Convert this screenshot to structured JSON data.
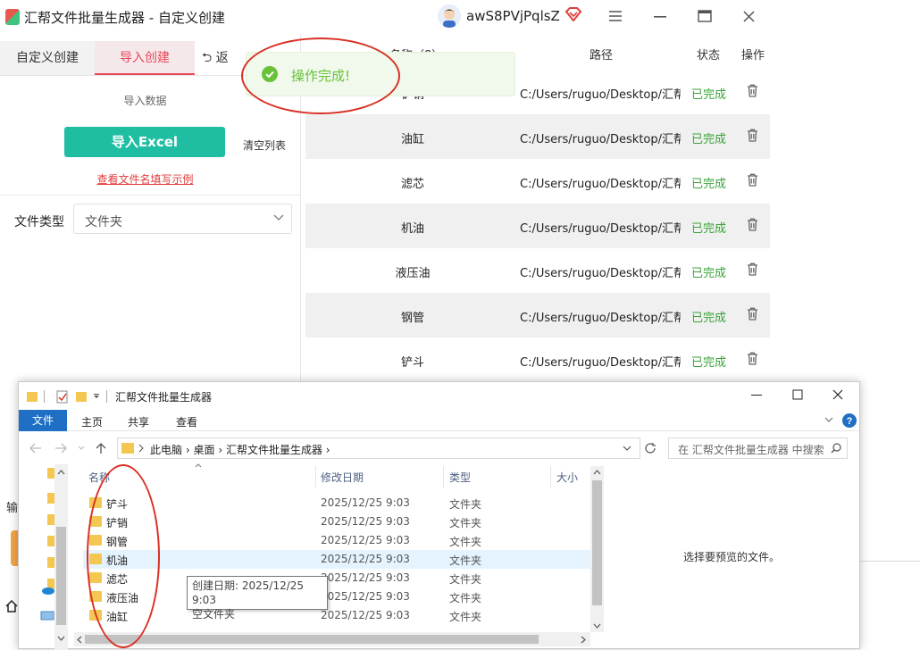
{
  "app": {
    "title": "汇帮文件批量生成器 - 自定义创建",
    "username": "awS8PVjPqlsZ"
  },
  "tabs": {
    "custom": "自定义创建",
    "import": "导入创建",
    "back": "返"
  },
  "left": {
    "import_data_label": "导入数据",
    "import_excel": "导入Excel",
    "clear_list": "清空列表",
    "example_link": "查看文件名填写示例",
    "file_type_label": "文件类型",
    "file_type_value": "文件夹",
    "out_label": "输"
  },
  "table": {
    "headers": {
      "name": "名称（8）",
      "path": "路径",
      "status": "状态",
      "op": "操作"
    },
    "rows": [
      {
        "name": "铲销",
        "path": "C:/Users/ruguo/Desktop/汇帮文",
        "status": "已完成"
      },
      {
        "name": "油缸",
        "path": "C:/Users/ruguo/Desktop/汇帮文",
        "status": "已完成"
      },
      {
        "name": "滤芯",
        "path": "C:/Users/ruguo/Desktop/汇帮文",
        "status": "已完成"
      },
      {
        "name": "机油",
        "path": "C:/Users/ruguo/Desktop/汇帮文",
        "status": "已完成"
      },
      {
        "name": "液压油",
        "path": "C:/Users/ruguo/Desktop/汇帮文",
        "status": "已完成"
      },
      {
        "name": "钢管",
        "path": "C:/Users/ruguo/Desktop/汇帮文",
        "status": "已完成"
      },
      {
        "name": "铲斗",
        "path": "C:/Users/ruguo/Desktop/汇帮文",
        "status": "已完成"
      }
    ]
  },
  "toast": {
    "text": "操作完成!"
  },
  "explorer": {
    "title": "汇帮文件批量生成器",
    "ribbon": {
      "file": "文件",
      "home": "主页",
      "share": "共享",
      "view": "查看"
    },
    "breadcrumb": [
      "此电脑",
      "桌面",
      "汇帮文件批量生成器"
    ],
    "search_placeholder": "在 汇帮文件批量生成器 中搜索",
    "columns": {
      "name": "名称",
      "date": "修改日期",
      "type": "类型",
      "size": "大小"
    },
    "files": [
      {
        "name": "铲斗",
        "date": "2025/12/25 9:03",
        "type": "文件夹"
      },
      {
        "name": "铲销",
        "date": "2025/12/25 9:03",
        "type": "文件夹"
      },
      {
        "name": "钢管",
        "date": "2025/12/25 9:03",
        "type": "文件夹"
      },
      {
        "name": "机油",
        "date": "2025/12/25 9:03",
        "type": "文件夹"
      },
      {
        "name": "滤芯",
        "date": "2025/12/25 9:03",
        "type": "文件夹"
      },
      {
        "name": "液压油",
        "date": "2025/12/25 9:03",
        "type": "文件夹"
      },
      {
        "name": "油缸",
        "date": "2025/12/25 9:03",
        "type": "文件夹"
      }
    ],
    "preview_text": "选择要预览的文件。",
    "tooltip": {
      "line1": "创建日期: 2025/12/25 9:03",
      "line2": "空文件夹"
    }
  },
  "colors": {
    "accent_teal": "#1fbea3",
    "accent_red": "#e8485a",
    "success_green": "#3aa33a",
    "annotation_red": "#d93025"
  }
}
